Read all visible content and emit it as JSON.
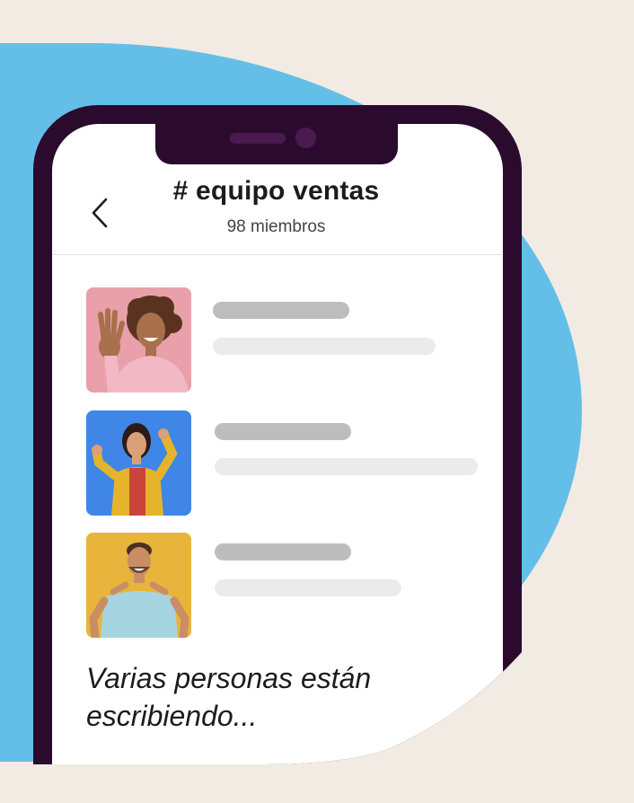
{
  "header": {
    "back_icon": "chevron-left-icon",
    "channel_name": "# equipo ventas",
    "member_count": "98 miembros"
  },
  "messages": [
    {
      "avatar": "woman-waving-photo",
      "avatar_bg": "#e9a0aa"
    },
    {
      "avatar": "woman-dancing-photo",
      "avatar_bg": "#3f86e6"
    },
    {
      "avatar": "man-pointing-photo",
      "avatar_bg": "#e8b43c"
    }
  ],
  "typing_indicator": "Varias personas están escribiendo...",
  "colors": {
    "background": "#f2ebe4",
    "blob": "#64bfe8",
    "phone_frame": "#2a0b2e",
    "placeholder_dark": "#bdbdbd",
    "placeholder_light": "#ebebeb"
  }
}
